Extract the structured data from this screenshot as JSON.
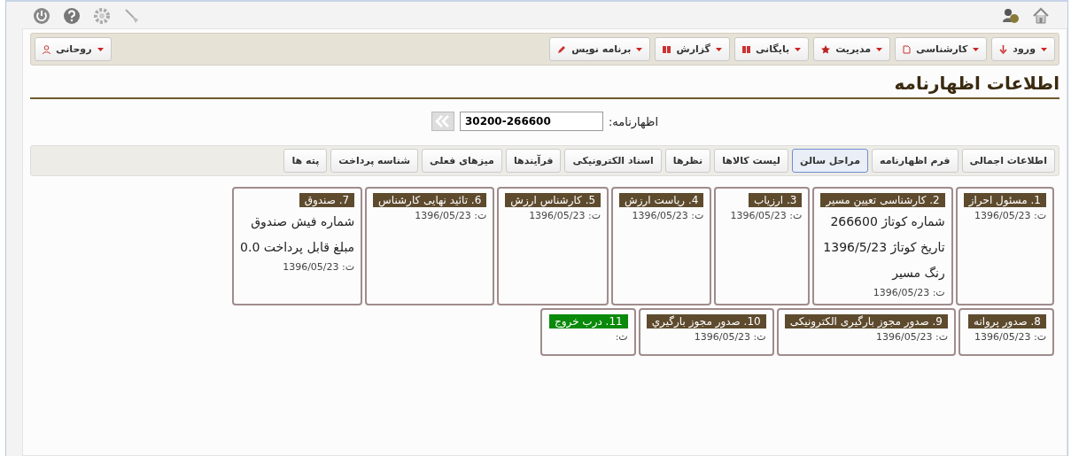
{
  "menu_right": [
    {
      "label": "ورود",
      "kind": "arrow"
    },
    {
      "label": "کارشناسی",
      "kind": "doc"
    },
    {
      "label": "مدیریت",
      "kind": "star"
    },
    {
      "label": "بایگانی",
      "kind": "book"
    },
    {
      "label": "گزارش",
      "kind": "book"
    },
    {
      "label": "برنامه نویس",
      "kind": "pencil"
    }
  ],
  "menu_left": [
    {
      "label": "روحانی",
      "kind": "user"
    }
  ],
  "page_title": "اطلاعات اظهارنامه",
  "declaration_field": {
    "label": "اظهارنامه:",
    "value": "30200-266600"
  },
  "tabs": [
    {
      "label": "اطلاعات اجمالی",
      "selected": false
    },
    {
      "label": "فرم اظهارنامه",
      "selected": false
    },
    {
      "label": "مراحل سالن",
      "selected": true
    },
    {
      "label": "لیست کالاها",
      "selected": false
    },
    {
      "label": "نظرها",
      "selected": false
    },
    {
      "label": "اسناد الکترونیکی",
      "selected": false
    },
    {
      "label": "فرآیندها",
      "selected": false
    },
    {
      "label": "میزهای فعلی",
      "selected": false
    },
    {
      "label": "شناسه پرداخت",
      "selected": false
    },
    {
      "label": "پته ها",
      "selected": false
    }
  ],
  "step_rows": [
    [
      {
        "title": "1. مسئول احراز",
        "color": "#5e4b2e",
        "date": "ت: 1396/05/23"
      },
      {
        "title": "2. کارشناسی تعیین مسیر",
        "color": "#5e4b2e",
        "lines": [
          "شماره کوتاژ 266600",
          "تاریخ کوتاژ  1396/5/23",
          "رنگ مسیر"
        ],
        "date": "ت: 1396/05/23"
      },
      {
        "title": "3. ارزیاب",
        "color": "#5e4b2e",
        "date": "ت: 1396/05/23"
      },
      {
        "title": "4. ریاست ارزش",
        "color": "#5e4b2e",
        "date": "ت: 1396/05/23"
      },
      {
        "title": "5. کارشناس ارزش",
        "color": "#5e4b2e",
        "date": "ت: 1396/05/23"
      },
      {
        "title": "6. تائید نهایی کارشناس",
        "color": "#5e4b2e",
        "date": "ت: 1396/05/23"
      },
      {
        "title": "7. صندوق",
        "color": "#5e4b2e",
        "lines": [
          "شماره فیش صندوق",
          "مبلغ قابل پرداخت  0.0"
        ],
        "date": "ت: 1396/05/23"
      }
    ],
    [
      {
        "title": "8. صدور پروانه",
        "color": "#5e4b2e",
        "date": "ت: 1396/05/23"
      },
      {
        "title": "9. صدور مجوز بارگیری الکترونیکی",
        "color": "#5e4b2e",
        "date": "ت: 1396/05/23"
      },
      {
        "title": "10. صدور مجوز بارگيري",
        "color": "#5e4b2e",
        "date": "ت: 1396/05/23"
      },
      {
        "title": "11. درب خروج",
        "color": "#0a8a0a",
        "date": "ت:"
      }
    ]
  ]
}
